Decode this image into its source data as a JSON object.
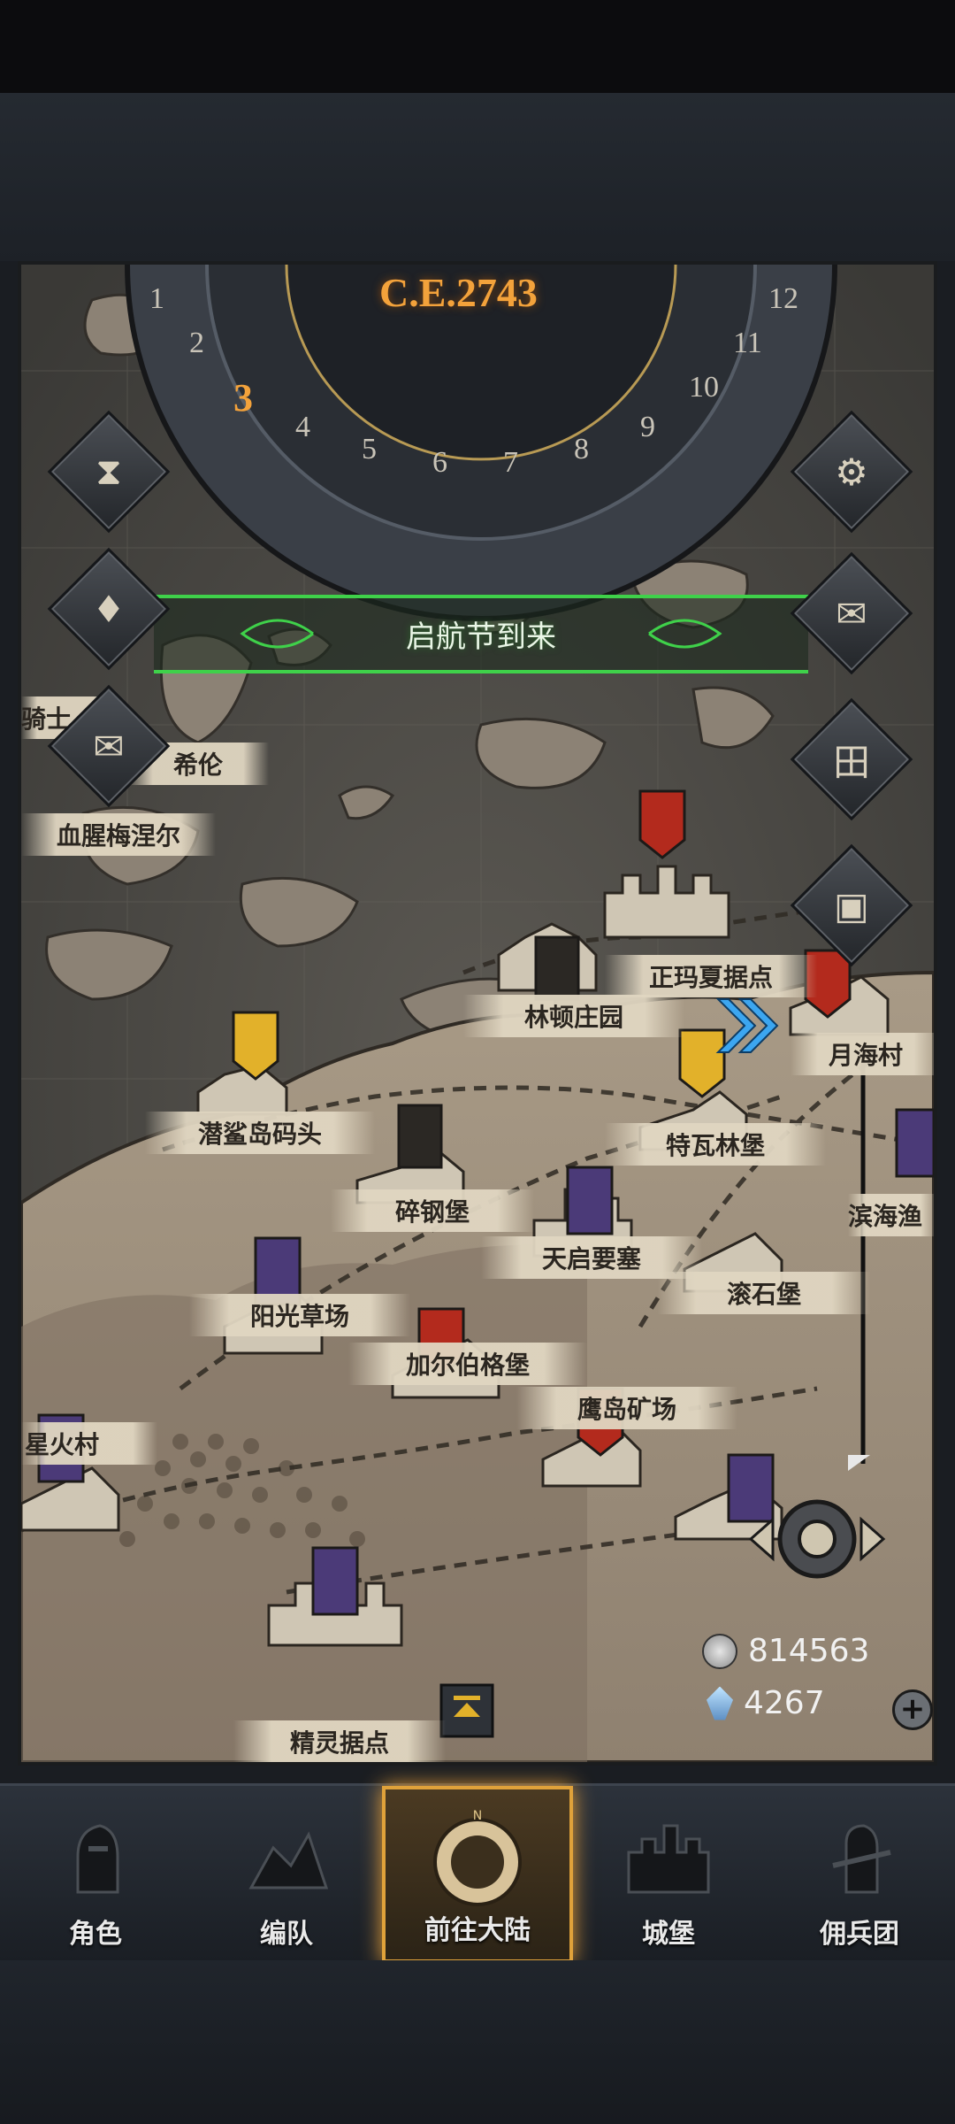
{
  "game": {
    "year": "C.E.2743",
    "dial_numbers": [
      "1",
      "2",
      "3",
      "4",
      "5",
      "6",
      "7",
      "8",
      "9",
      "10",
      "11",
      "12"
    ],
    "current_month": "3"
  },
  "event_banner": {
    "text": "启航节到来"
  },
  "places": [
    {
      "id": "zhengmaxia",
      "label": "正玛夏据点"
    },
    {
      "id": "lindun",
      "label": "林顿庄园"
    },
    {
      "id": "yuehai",
      "label": "月海村"
    },
    {
      "id": "qiansha",
      "label": "潜鲨岛码头"
    },
    {
      "id": "tewalin",
      "label": "特瓦林堡"
    },
    {
      "id": "suigang",
      "label": "碎钢堡"
    },
    {
      "id": "binhai",
      "label": "滨海渔"
    },
    {
      "id": "tianqi",
      "label": "天启要塞"
    },
    {
      "id": "gunshi",
      "label": "滚石堡"
    },
    {
      "id": "yangguang",
      "label": "阳光草场"
    },
    {
      "id": "jiaerbo",
      "label": "加尔伯格堡"
    },
    {
      "id": "yingdao",
      "label": "鹰岛矿场"
    },
    {
      "id": "xinghuo",
      "label": "星火村"
    },
    {
      "id": "jingling",
      "label": "精灵据点"
    },
    {
      "id": "xuexing",
      "label": "血腥梅涅尔"
    },
    {
      "id": "xilun",
      "label": "希伦"
    },
    {
      "id": "qishi",
      "label": "骑士"
    }
  ],
  "resources": {
    "silver": "814563",
    "crystal": "4267"
  },
  "side_buttons": {
    "left": [
      "hourglass-icon",
      "money-bag-icon",
      "scroll-icon"
    ],
    "right": [
      "gear-icon",
      "mail-icon",
      "grid-icon",
      "supply-icon"
    ]
  },
  "tabs": [
    {
      "label": "角色",
      "icon": "knight-icon"
    },
    {
      "label": "编队",
      "icon": "formation-icon"
    },
    {
      "label": "前往大陆",
      "icon": "compass-icon",
      "active": true
    },
    {
      "label": "城堡",
      "icon": "castle-icon"
    },
    {
      "label": "佣兵团",
      "icon": "mercenary-icon"
    }
  ],
  "colors": {
    "accent_gold": "#e0a23a",
    "event_green": "#3fd14a",
    "banner_red": "#b32a1d",
    "banner_purple": "#4b3a78",
    "banner_gold": "#e2b12a",
    "year_orange": "#f3a23b"
  }
}
